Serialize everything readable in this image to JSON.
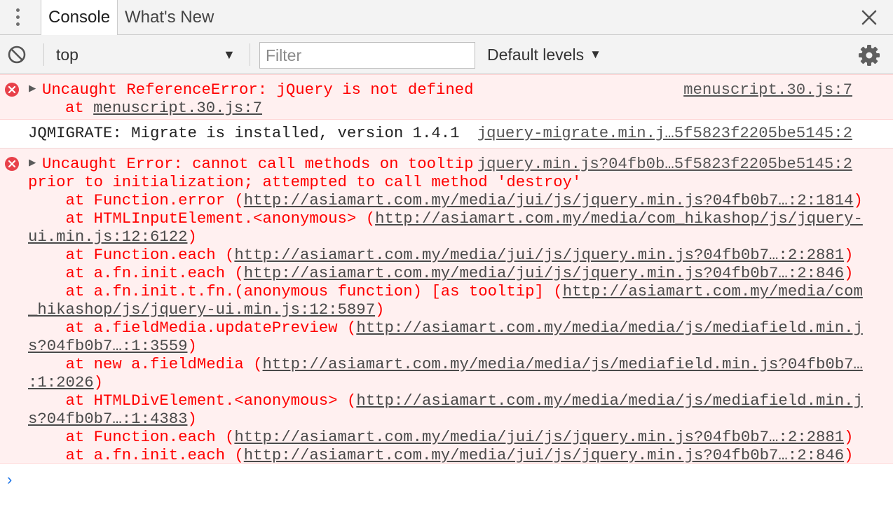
{
  "tabs": {
    "console": "Console",
    "whats_new": "What's New"
  },
  "toolbar": {
    "context_value": "top",
    "filter_placeholder": "Filter",
    "levels_label": "Default levels"
  },
  "messages": {
    "m1": {
      "text": "Uncaught ReferenceError: jQuery is not defined",
      "source": "menuscript.30.js:7",
      "at": "at ",
      "at_link": "menuscript.30.js:7"
    },
    "m2": {
      "text": "JQMIGRATE: Migrate is installed, version 1.4.1",
      "source": "jquery-migrate.min.j…5f5823f2205be5145:2"
    },
    "m3": {
      "line1": "Uncaught Error: cannot call methods on tooltip",
      "source": "jquery.min.js?04fb0b…5f5823f2205be5145:2",
      "line2": "prior to initialization; attempted to call method 'destroy'",
      "stack": [
        {
          "pre": "    at Function.error (",
          "link": "http://asiamart.com.my/media/jui/js/jquery.min.js?04fb0b7…:2:1814",
          "post": ")"
        },
        {
          "pre": "    at HTMLInputElement.<anonymous> (",
          "link": "http://asiamart.com.my/media/com_hikashop/js/jquery-",
          "post": ""
        },
        {
          "pre": "",
          "link": "ui.min.js:12:6122",
          "post": ")"
        },
        {
          "pre": "    at Function.each (",
          "link": "http://asiamart.com.my/media/jui/js/jquery.min.js?04fb0b7…:2:2881",
          "post": ")"
        },
        {
          "pre": "    at a.fn.init.each (",
          "link": "http://asiamart.com.my/media/jui/js/jquery.min.js?04fb0b7…:2:846",
          "post": ")"
        },
        {
          "pre": "    at a.fn.init.t.fn.(anonymous function) [as tooltip] (",
          "link": "http://asiamart.com.my/media/com",
          "post": ""
        },
        {
          "pre": "",
          "link": "_hikashop/js/jquery-ui.min.js:12:5897",
          "post": ")"
        },
        {
          "pre": "    at a.fieldMedia.updatePreview (",
          "link": "http://asiamart.com.my/media/media/js/mediafield.min.j",
          "post": ""
        },
        {
          "pre": "",
          "link": "s?04fb0b7…:1:3559",
          "post": ")"
        },
        {
          "pre": "    at new a.fieldMedia (",
          "link": "http://asiamart.com.my/media/media/js/mediafield.min.js?04fb0b7…",
          "post": ""
        },
        {
          "pre": "",
          "link": ":1:2026",
          "post": ")"
        },
        {
          "pre": "    at HTMLDivElement.<anonymous> (",
          "link": "http://asiamart.com.my/media/media/js/mediafield.min.j",
          "post": ""
        },
        {
          "pre": "",
          "link": "s?04fb0b7…:1:4383",
          "post": ")"
        },
        {
          "pre": "    at Function.each (",
          "link": "http://asiamart.com.my/media/jui/js/jquery.min.js?04fb0b7…:2:2881",
          "post": ")"
        },
        {
          "pre": "    at a.fn.init.each (",
          "link": "http://asiamart.com.my/media/jui/js/jquery.min.js?04fb0b7…:2:846",
          "post": ")"
        }
      ]
    }
  },
  "prompt_symbol": "›",
  "icons": {
    "menu": "kebab-menu-icon",
    "close": "close-icon",
    "clear": "clear-console-icon",
    "settings": "gear-icon",
    "error": "error-icon",
    "expand": "expand-triangle-icon"
  },
  "colors": {
    "error_text": "#ff0000",
    "error_bg": "#fff0f0",
    "prompt": "#1a73e8"
  }
}
